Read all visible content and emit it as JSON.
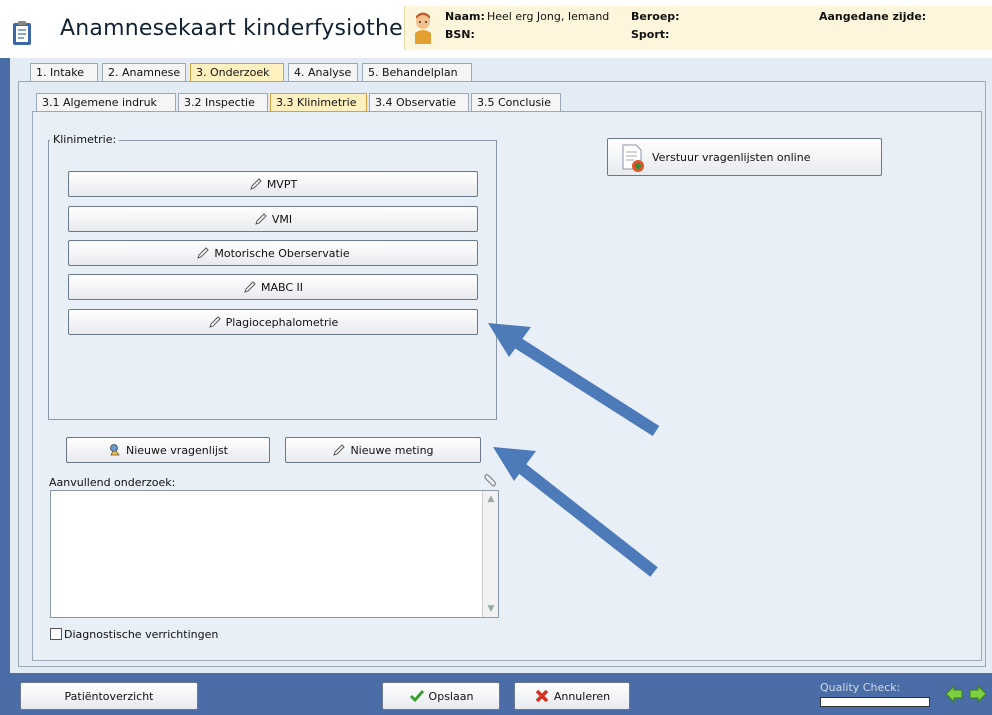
{
  "app": {
    "title": "Anamnesekaart kinderfysiotherapie"
  },
  "patient": {
    "naam_label": "Naam:",
    "naam_value": "Heel erg Jong, Iemand",
    "bsn_label": "BSN:",
    "beroep_label": "Beroep:",
    "sport_label": "Sport:",
    "aangedane_label": "Aangedane zijde:"
  },
  "tabs": [
    "1. Intake",
    "2. Anamnese",
    "3. Onderzoek",
    "4. Analyse",
    "5. Behandelplan"
  ],
  "subtabs": [
    "3.1 Algemene indruk",
    "3.2 Inspectie",
    "3.3 Klinimetrie",
    "3.4 Observatie",
    "3.5 Conclusie"
  ],
  "klinimetrie": {
    "legend": "Klinimetrie:",
    "buttons": [
      "MVPT",
      "VMI",
      "Motorische Oberservatie",
      "MABC II",
      "Plagiocephalometrie"
    ]
  },
  "actions": {
    "nieuwe_vragenlijst": "Nieuwe vragenlijst",
    "nieuwe_meting": "Nieuwe meting",
    "verstuur": "Verstuur vragenlijsten online"
  },
  "aanvullend": {
    "label": "Aanvullend onderzoek:",
    "value": ""
  },
  "diagnostische": {
    "label": "Diagnostische verrichtingen",
    "checked": false
  },
  "footer": {
    "patientoverzicht": "Patiëntoverzicht",
    "opslaan": "Opslaan",
    "annuleren": "Annuleren",
    "quality_check": "Quality Check:"
  },
  "colors": {
    "accent": "#4a6da8",
    "annotation_arrow": "#4d7ab8"
  }
}
